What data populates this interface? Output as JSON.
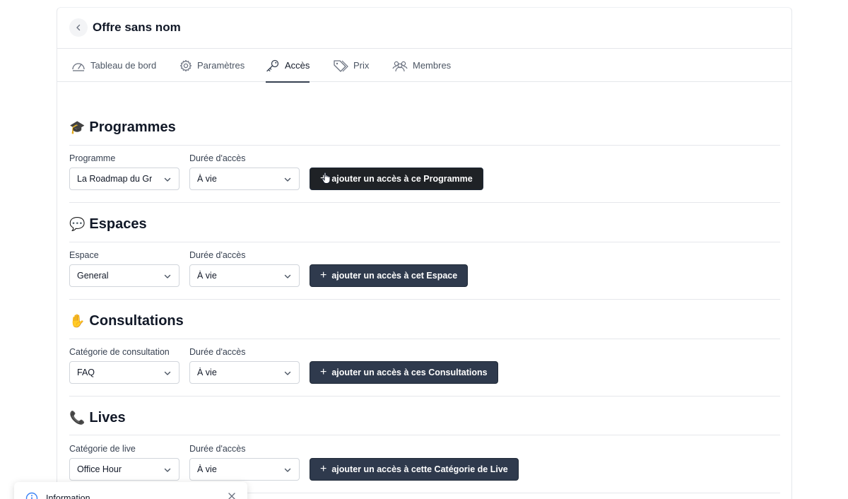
{
  "header": {
    "title": "Offre sans nom"
  },
  "tabs": [
    {
      "label": "Tableau de bord",
      "icon": "dashboard-icon"
    },
    {
      "label": "Paramètres",
      "icon": "gear-icon"
    },
    {
      "label": "Accès",
      "icon": "key-icon",
      "active": true
    },
    {
      "label": "Prix",
      "icon": "tag-icon"
    },
    {
      "label": "Membres",
      "icon": "users-icon"
    }
  ],
  "sections": [
    {
      "emoji": "🎓",
      "title": "Programmes",
      "field_label": "Programme",
      "field_value": "La Roadmap du Gra",
      "duration_label": "Durée d'accès",
      "duration_value": "À vie",
      "button": "ajouter un accès à ce Programme"
    },
    {
      "emoji": "💬",
      "title": "Espaces",
      "field_label": "Espace",
      "field_value": "General",
      "duration_label": "Durée d'accès",
      "duration_value": "À vie",
      "button": "ajouter un accès à cet Espace"
    },
    {
      "emoji": "✋",
      "title": "Consultations",
      "field_label": "Catégorie de consultation",
      "field_value": "FAQ",
      "duration_label": "Durée d'accès",
      "duration_value": "À vie",
      "button": "ajouter un accès à ces Consultations"
    },
    {
      "emoji": "📞",
      "title": "Lives",
      "field_label": "Catégorie de live",
      "field_value": "Office Hour",
      "duration_label": "Durée d'accès",
      "duration_value": "À vie",
      "button": "ajouter un accès à cette Catégorie de Live"
    }
  ],
  "toast": {
    "text": "Information"
  },
  "colors": {
    "button_bg": "#2f3a4d",
    "button_hover_bg": "#1f2226",
    "border": "#e5e7eb"
  }
}
